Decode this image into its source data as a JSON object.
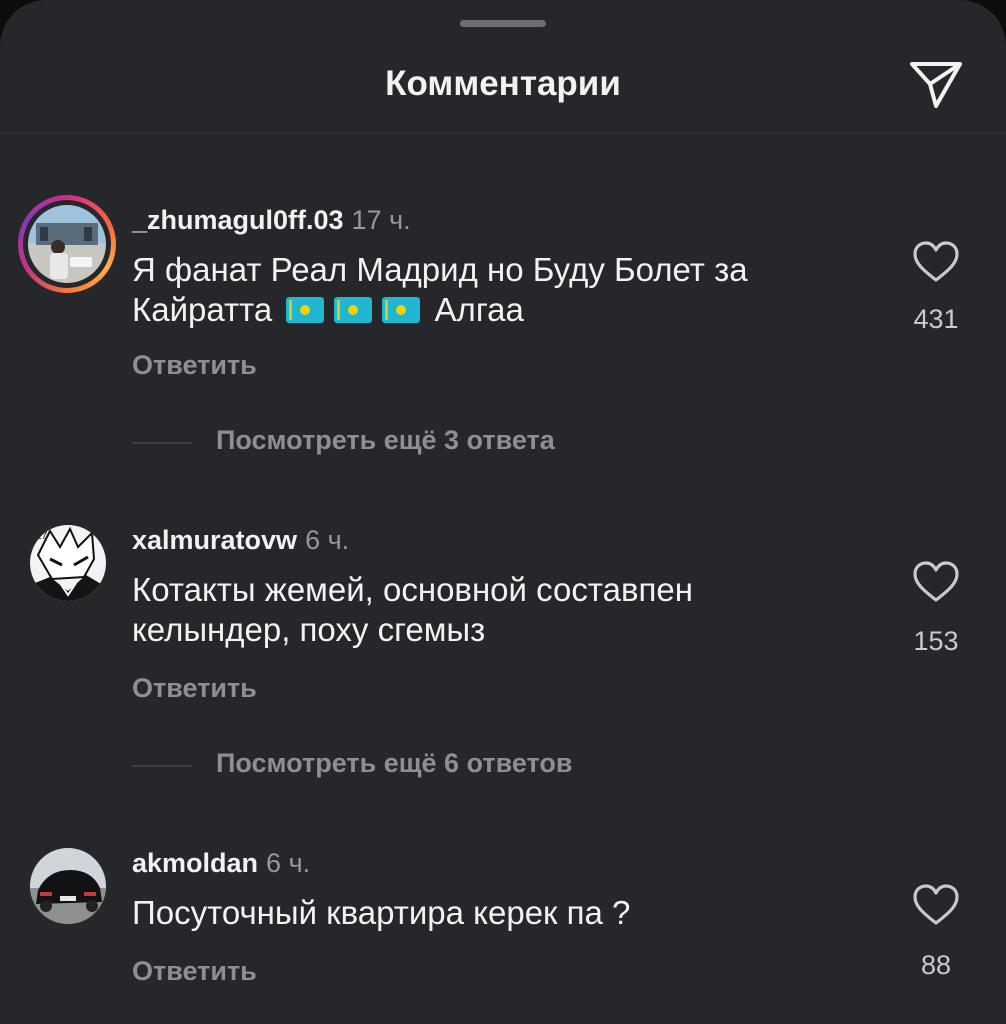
{
  "header": {
    "title": "Комментарии",
    "share_icon": "send-icon"
  },
  "comments": [
    {
      "username": "_zhumagul0ff.03",
      "time": "17 ч.",
      "text_line1": "Я фанат Реал Мадрид но Буду Болет за",
      "text_line2_before": "Кайратта",
      "flags": [
        "🇰🇿",
        "🇰🇿",
        "🇰🇿"
      ],
      "text_line2_after": "Алгаа",
      "likes": "431",
      "reply_label": "Ответить",
      "view_replies": "Посмотреть ещё 3 ответа",
      "has_story_ring": true
    },
    {
      "username": "xalmuratovw",
      "time": "6 ч.",
      "text_line1": "Котакты жемей, основной составпен",
      "text_line2": "келындер, поху сгемыз",
      "likes": "153",
      "reply_label": "Ответить",
      "view_replies": "Посмотреть ещё 6 ответов"
    },
    {
      "username": "akmoldan",
      "time": "6 ч.",
      "text_line1": "Посуточный квартира керек па ?",
      "likes": "88",
      "reply_label": "Ответить"
    }
  ],
  "colors": {
    "background": "#26272b",
    "text_primary": "#f2f2f4",
    "text_secondary": "#8e8f94"
  }
}
